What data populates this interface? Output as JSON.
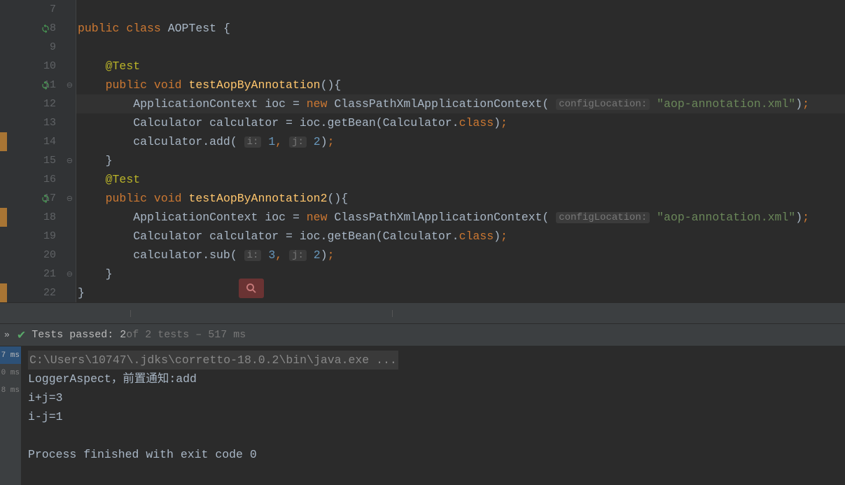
{
  "editor": {
    "lines": [
      {
        "num": "7",
        "segments": []
      },
      {
        "num": "8",
        "refresh": true,
        "segments": [
          {
            "t": "kw",
            "v": "public "
          },
          {
            "t": "kw",
            "v": "class "
          },
          {
            "t": "plain",
            "v": "AOPTest "
          },
          {
            "t": "punc",
            "v": "{"
          }
        ]
      },
      {
        "num": "9",
        "segments": []
      },
      {
        "num": "10",
        "segments": [
          {
            "t": "plain",
            "v": "    "
          },
          {
            "t": "anno",
            "v": "@Test"
          }
        ]
      },
      {
        "num": "11",
        "refresh": true,
        "fold": true,
        "segments": [
          {
            "t": "plain",
            "v": "    "
          },
          {
            "t": "kw",
            "v": "public "
          },
          {
            "t": "kw",
            "v": "void "
          },
          {
            "t": "method",
            "v": "testAopByAnnotation"
          },
          {
            "t": "paren",
            "v": "(){"
          }
        ]
      },
      {
        "num": "12",
        "highlighted": true,
        "segments": [
          {
            "t": "plain",
            "v": "        ApplicationContext ioc = "
          },
          {
            "t": "kw",
            "v": "new "
          },
          {
            "t": "plain",
            "v": "ClassPathXmlApplicationContext( "
          },
          {
            "t": "hint",
            "v": "configLocation:"
          },
          {
            "t": "plain",
            "v": " "
          },
          {
            "t": "str",
            "v": "\"aop-annotation.xml\""
          },
          {
            "t": "paren",
            "v": ")"
          },
          {
            "t": "semi",
            "v": ";"
          }
        ]
      },
      {
        "num": "13",
        "segments": [
          {
            "t": "plain",
            "v": "        Calculator calculator = ioc.getBean(Calculator."
          },
          {
            "t": "kw",
            "v": "class"
          },
          {
            "t": "paren",
            "v": ")"
          },
          {
            "t": "semi",
            "v": ";"
          }
        ]
      },
      {
        "num": "14",
        "errorStrip": true,
        "segments": [
          {
            "t": "plain",
            "v": "        calculator.add( "
          },
          {
            "t": "hint",
            "v": "i:"
          },
          {
            "t": "plain",
            "v": " "
          },
          {
            "t": "num",
            "v": "1"
          },
          {
            "t": "comma",
            "v": ","
          },
          {
            "t": "plain",
            "v": " "
          },
          {
            "t": "hint",
            "v": "j:"
          },
          {
            "t": "plain",
            "v": " "
          },
          {
            "t": "num",
            "v": "2"
          },
          {
            "t": "paren",
            "v": ")"
          },
          {
            "t": "semi",
            "v": ";"
          }
        ]
      },
      {
        "num": "15",
        "fold": true,
        "segments": [
          {
            "t": "plain",
            "v": "    "
          },
          {
            "t": "punc",
            "v": "}"
          }
        ]
      },
      {
        "num": "16",
        "segments": [
          {
            "t": "plain",
            "v": "    "
          },
          {
            "t": "anno",
            "v": "@Test"
          }
        ]
      },
      {
        "num": "17",
        "refresh": true,
        "fold": true,
        "segments": [
          {
            "t": "plain",
            "v": "    "
          },
          {
            "t": "kw",
            "v": "public "
          },
          {
            "t": "kw",
            "v": "void "
          },
          {
            "t": "method",
            "v": "testAopByAnnotation2"
          },
          {
            "t": "paren",
            "v": "(){"
          }
        ]
      },
      {
        "num": "18",
        "errorStrip": true,
        "segments": [
          {
            "t": "plain",
            "v": "        ApplicationContext ioc = "
          },
          {
            "t": "kw",
            "v": "new "
          },
          {
            "t": "plain",
            "v": "ClassPathXmlApplicationContext( "
          },
          {
            "t": "hint",
            "v": "configLocation:"
          },
          {
            "t": "plain",
            "v": " "
          },
          {
            "t": "str",
            "v": "\"aop-annotation.xml\""
          },
          {
            "t": "paren",
            "v": ")"
          },
          {
            "t": "semi",
            "v": ";"
          }
        ]
      },
      {
        "num": "19",
        "segments": [
          {
            "t": "plain",
            "v": "        Calculator calculator = ioc.getBean(Calculator."
          },
          {
            "t": "kw",
            "v": "class"
          },
          {
            "t": "paren",
            "v": ")"
          },
          {
            "t": "semi",
            "v": ";"
          }
        ]
      },
      {
        "num": "20",
        "segments": [
          {
            "t": "plain",
            "v": "        calculator.sub( "
          },
          {
            "t": "hint",
            "v": "i:"
          },
          {
            "t": "plain",
            "v": " "
          },
          {
            "t": "num",
            "v": "3"
          },
          {
            "t": "comma",
            "v": ","
          },
          {
            "t": "plain",
            "v": " "
          },
          {
            "t": "hint",
            "v": "j:"
          },
          {
            "t": "plain",
            "v": " "
          },
          {
            "t": "num",
            "v": "2"
          },
          {
            "t": "paren",
            "v": ")"
          },
          {
            "t": "semi",
            "v": ";"
          }
        ]
      },
      {
        "num": "21",
        "fold": true,
        "segments": [
          {
            "t": "plain",
            "v": "    "
          },
          {
            "t": "punc",
            "v": "}"
          }
        ]
      },
      {
        "num": "22",
        "errorStrip": true,
        "segments": [
          {
            "t": "punc",
            "v": "}"
          }
        ]
      }
    ]
  },
  "testBar": {
    "passed": "Tests passed: 2",
    "detail": " of 2 tests – 517 ms"
  },
  "timeColumn": {
    "times": [
      "7 ms",
      "0 ms",
      "8 ms"
    ]
  },
  "console": {
    "cmd": "C:\\Users\\10747\\.jdks\\corretto-18.0.2\\bin\\java.exe ...",
    "lines": [
      "LoggerAspect，前置通知:add",
      "i+j=3",
      "i-j=1",
      "",
      "Process finished with exit code 0"
    ]
  }
}
